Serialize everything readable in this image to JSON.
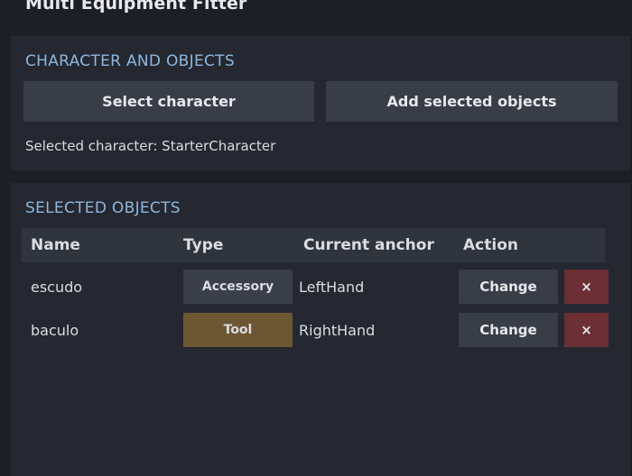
{
  "window": {
    "title": "Multi Equipment Fitter"
  },
  "character_panel": {
    "title": "CHARACTER AND OBJECTS",
    "select_button": "Select character",
    "add_button": "Add selected objects",
    "selected_text": "Selected character: StarterCharacter"
  },
  "objects_panel": {
    "title": "SELECTED OBJECTS",
    "headers": {
      "name": "Name",
      "type": "Type",
      "anchor": "Current anchor",
      "action": "Action"
    },
    "rows": [
      {
        "name": "escudo",
        "type": "Accessory",
        "type_color": "#3b3f49",
        "anchor": "LeftHand",
        "change": "Change",
        "remove": "×"
      },
      {
        "name": "baculo",
        "type": "Tool",
        "type_color": "#6d5632",
        "anchor": "RightHand",
        "change": "Change",
        "remove": "×"
      }
    ]
  },
  "colors": {
    "background": "#1c1f24",
    "panel": "#252830",
    "accent": "#8fb6dd",
    "remove_button": "#6b2f34"
  }
}
